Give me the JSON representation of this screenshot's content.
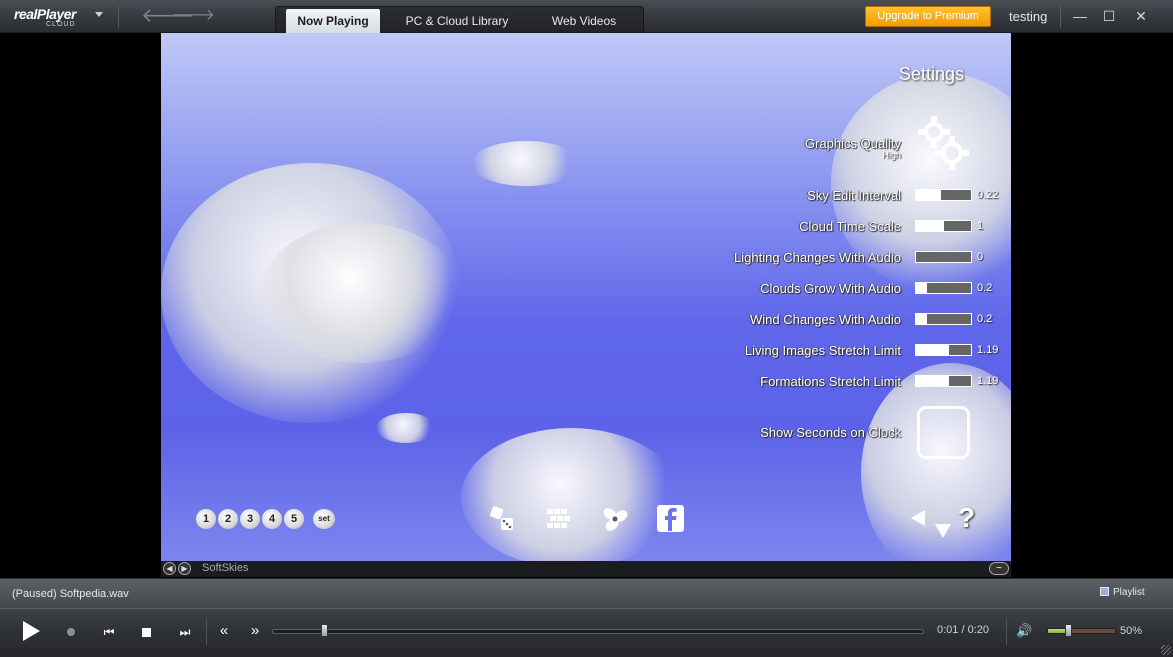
{
  "app": {
    "logo_text": "realPlayer",
    "logo_sub": "CLOUD"
  },
  "tabs": [
    {
      "label": "Now Playing",
      "active": true
    },
    {
      "label": "PC & Cloud Library",
      "active": false
    },
    {
      "label": "Web Videos",
      "active": false
    }
  ],
  "header": {
    "upgrade_label": "Upgrade to Premium",
    "username": "testing",
    "minimize_glyph": "—",
    "maximize_glyph": "☐",
    "close_glyph": "✕",
    "back_glyph": "🡐",
    "forward_glyph": "🡒"
  },
  "settings": {
    "title": "Settings",
    "graphics_quality": {
      "label": "Graphics Quality",
      "value": "High"
    },
    "sliders": [
      {
        "label": "Sky Edit Interval",
        "value": "0.22",
        "fraction": 0.45
      },
      {
        "label": "Cloud Time Scale",
        "value": "1",
        "fraction": 0.5
      },
      {
        "label": "Lighting Changes With Audio",
        "value": "0",
        "fraction": 0.0
      },
      {
        "label": "Clouds Grow With Audio",
        "value": "0.2",
        "fraction": 0.2
      },
      {
        "label": "Wind Changes With Audio",
        "value": "0.2",
        "fraction": 0.2
      },
      {
        "label": "Living Images Stretch Limit",
        "value": "1.19",
        "fraction": 0.6
      },
      {
        "label": "Formations Stretch Limit",
        "value": "1.19",
        "fraction": 0.6
      }
    ],
    "show_seconds": {
      "label": "Show Seconds on Clock",
      "checked": false
    }
  },
  "presets": {
    "numbers": [
      "1",
      "2",
      "3",
      "4",
      "5"
    ],
    "set_label": "set"
  },
  "scene_icons": [
    "dice-icon",
    "grid-icon",
    "fan-icon",
    "facebook-icon"
  ],
  "visualization": {
    "name": "SoftSkies",
    "help_glyph": "?"
  },
  "status": {
    "text": "(Paused) Softpedia.wav",
    "playlist_label": "Playlist"
  },
  "playback": {
    "time": "0:01 / 0:20",
    "progress_fraction": 0.08,
    "volume_label": "50%",
    "volume_fraction": 0.3,
    "rewind_glyph": "«",
    "ffwd_glyph": "»",
    "prev_glyph": "⏮",
    "next_glyph": "⏭",
    "volume_glyph": "🔊"
  },
  "colors": {
    "upgrade": "#f39b00",
    "sky_top": "#bfc8f5",
    "sky_mid": "#5f66ea",
    "volume_fill": "#7fb83a"
  }
}
